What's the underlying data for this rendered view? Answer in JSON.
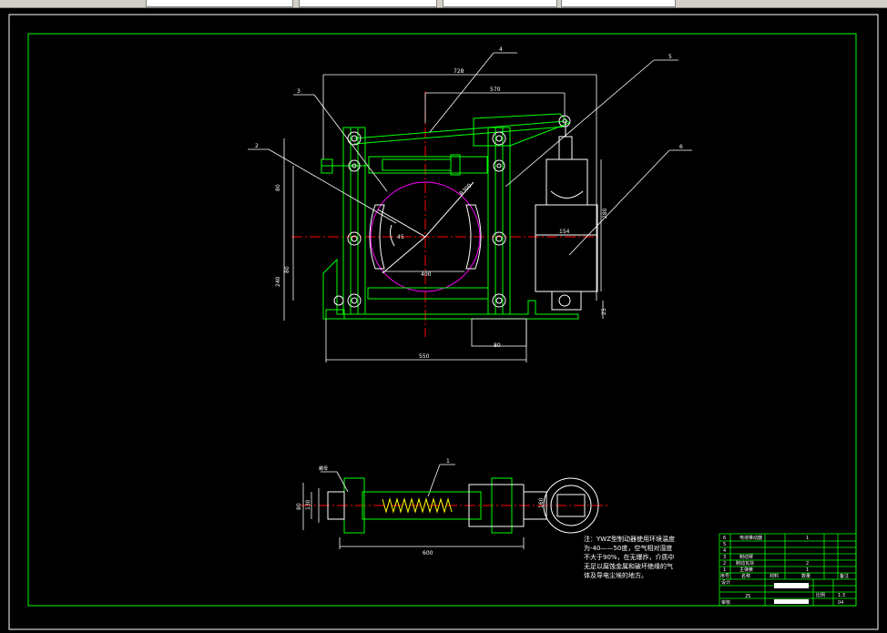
{
  "toolbar": {
    "fields": [
      "",
      "",
      "",
      ""
    ]
  },
  "colors": {
    "background": "#000000",
    "frame": "#00ff00",
    "dimension": "#ffffff",
    "drum": "#ff00ff",
    "part": "#00ff00",
    "center": "#ff0000",
    "leader": "#ffffff",
    "spring": "#ffff00"
  },
  "drawing": {
    "dims": {
      "total_width_top": "728",
      "inner_width": "570",
      "height_left": "80",
      "height_lower": "80",
      "height_240": "240",
      "angle": "45",
      "radius": "R300",
      "drum_dia": "400",
      "motor_height": "280",
      "motor_dia": "154",
      "base_width": "550",
      "base_small": "80",
      "base_offset": "25",
      "plan_length": "600",
      "plan_h1": "80",
      "plan_h2": "130",
      "plan_h3": "160"
    },
    "balloons": [
      "1",
      "2",
      "3",
      "4",
      "5",
      "6"
    ],
    "note_label": "螺母",
    "note_lines": [
      "注：YWZ型制动器使用环境温度",
      "为-40——50度，空气相对湿度",
      "不大于90%，在无爆炸，介质中",
      "无足以腐蚀金属和破坏绝缘的气",
      "体及导电尘埃的地方。"
    ]
  },
  "title_block": {
    "rows": [
      {
        "no": "6",
        "name": "电液推动器",
        "qty": "1"
      },
      {
        "no": "5",
        "name": "",
        "qty": ""
      },
      {
        "no": "4",
        "name": "",
        "qty": ""
      },
      {
        "no": "3",
        "name": "制动臂",
        "qty": ""
      },
      {
        "no": "2",
        "name": "制动瓦块",
        "qty": "2"
      },
      {
        "no": "1",
        "name": "主弹簧",
        "qty": "1"
      }
    ],
    "header": [
      "序号",
      "名称",
      "材料",
      "数量",
      "备注"
    ],
    "scale_label": "比例",
    "scale_value": "1:3",
    "sheet_value": "04",
    "code_value": "25",
    "design_label": "设计",
    "review_label": "审核"
  }
}
